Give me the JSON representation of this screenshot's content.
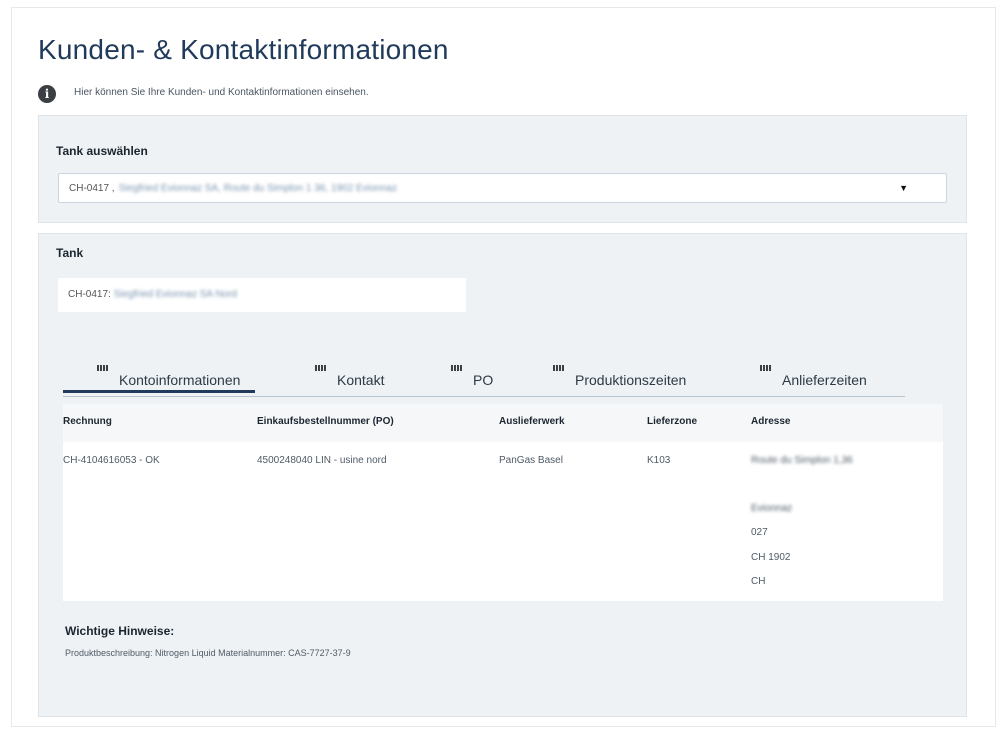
{
  "header": {
    "title": "Kunden- & Kontaktinformationen",
    "info_text": "Hier können Sie Ihre Kunden- und Kontaktinformationen einsehen."
  },
  "tank_select": {
    "label": "Tank auswählen",
    "selected_id": "CH-0417 ,",
    "selected_detail_redacted": "Siegfried Evionnaz SA, Route du Simplon 1 36, 1902 Evionnaz"
  },
  "tank": {
    "label": "Tank",
    "field_prefix": "CH-0417:",
    "field_redacted": "Siegfried Evionnaz SA Nord"
  },
  "tabs": [
    {
      "label": "Kontoinformationen",
      "active": true
    },
    {
      "label": "Kontakt",
      "active": false
    },
    {
      "label": "PO",
      "active": false
    },
    {
      "label": "Produktionszeiten",
      "active": false
    },
    {
      "label": "Anlieferzeiten",
      "active": false
    }
  ],
  "table": {
    "headers": [
      "Rechnung",
      "Einkaufsbestellnummer (PO)",
      "Auslieferwerk",
      "Lieferzone",
      "Adresse"
    ],
    "row": {
      "rechnung": "CH-4104616053 - OK",
      "po": "4500248040 LIN - usine nord",
      "auslieferwerk": "PanGas Basel",
      "lieferzone": "K103",
      "address_street_redacted": "Route du Simplon 1,36",
      "address_city_redacted": "Evionnaz",
      "address_code": "027",
      "address_zip": "CH 1902",
      "address_country": "CH"
    }
  },
  "notes": {
    "title": "Wichtige Hinweise:",
    "text": "Produktbeschreibung: Nitrogen Liquid Materialnummer: CAS-7727-37-9"
  }
}
